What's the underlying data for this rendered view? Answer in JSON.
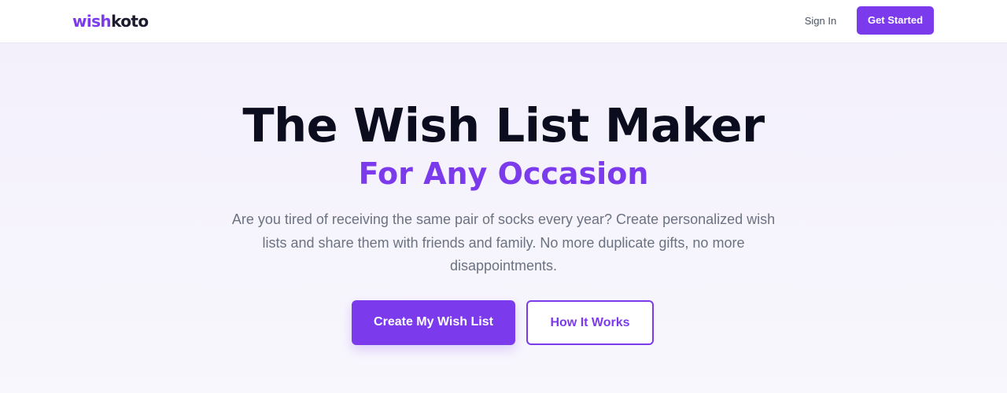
{
  "header": {
    "logo": {
      "part1": "wish",
      "part2": "koto"
    },
    "sign_in_label": "Sign In",
    "get_started_label": "Get Started"
  },
  "hero": {
    "title": "The Wish List Maker",
    "subtitle": "For Any Occasion",
    "description": "Are you tired of receiving the same pair of socks every year? Create personalized wish lists and share them with friends and family. No more duplicate gifts, no more disappointments.",
    "primary_cta_label": "Create My Wish List",
    "secondary_cta_label": "How It Works"
  },
  "colors": {
    "brand": "#7c3aed",
    "heading": "#0b0d1f",
    "body_text": "#6b7280",
    "background": "#f5f3fc"
  }
}
